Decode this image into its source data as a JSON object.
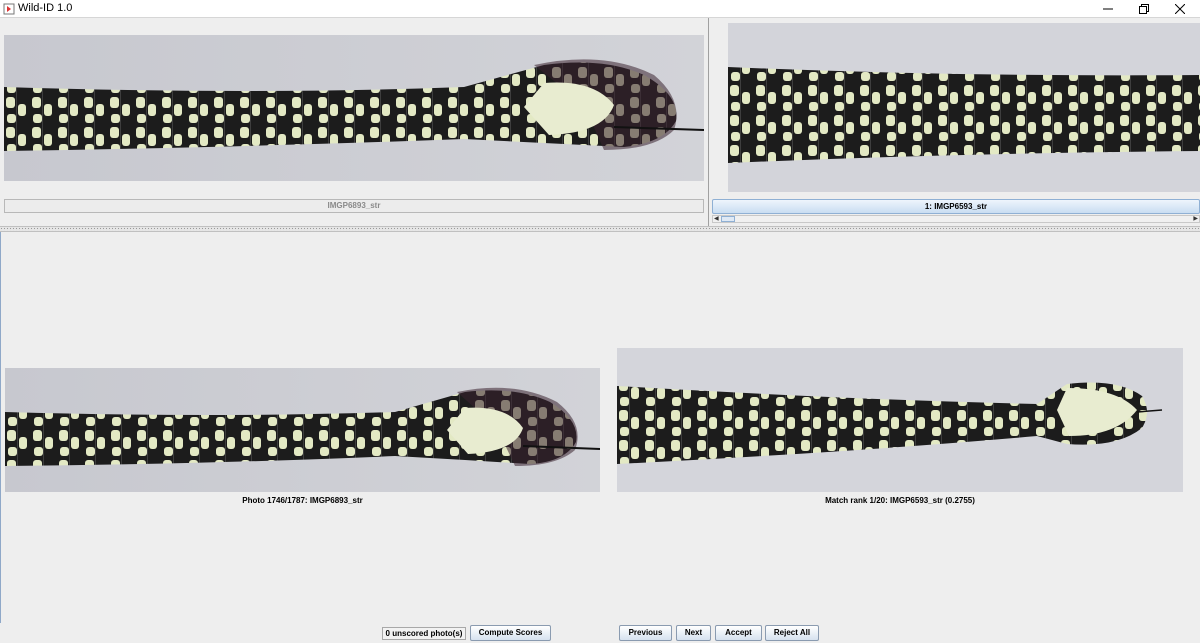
{
  "window": {
    "title": "Wild-ID 1.0",
    "controls": [
      "minimize",
      "restore",
      "close"
    ]
  },
  "top_left": {
    "image_label": "IMGP6893_str"
  },
  "top_right": {
    "match_header": "1:  IMGP6593_str"
  },
  "bottom": {
    "left_caption": "Photo 1746/1787: IMGP6893_str",
    "right_caption": "Match rank 1/20: IMGP6593_str (0.2755)"
  },
  "toolbar": {
    "status": "0 unscored photo(s)",
    "compute_label": "Compute Scores",
    "previous_label": "Previous",
    "next_label": "Next",
    "accept_label": "Accept",
    "reject_all_label": "Reject All"
  },
  "colors": {
    "snake_dark": "#1a1a1a",
    "snake_light": "#e3e9c4",
    "photo_bg": "#c9cad0",
    "button_gradient_bottom": "#d6e2ef"
  }
}
